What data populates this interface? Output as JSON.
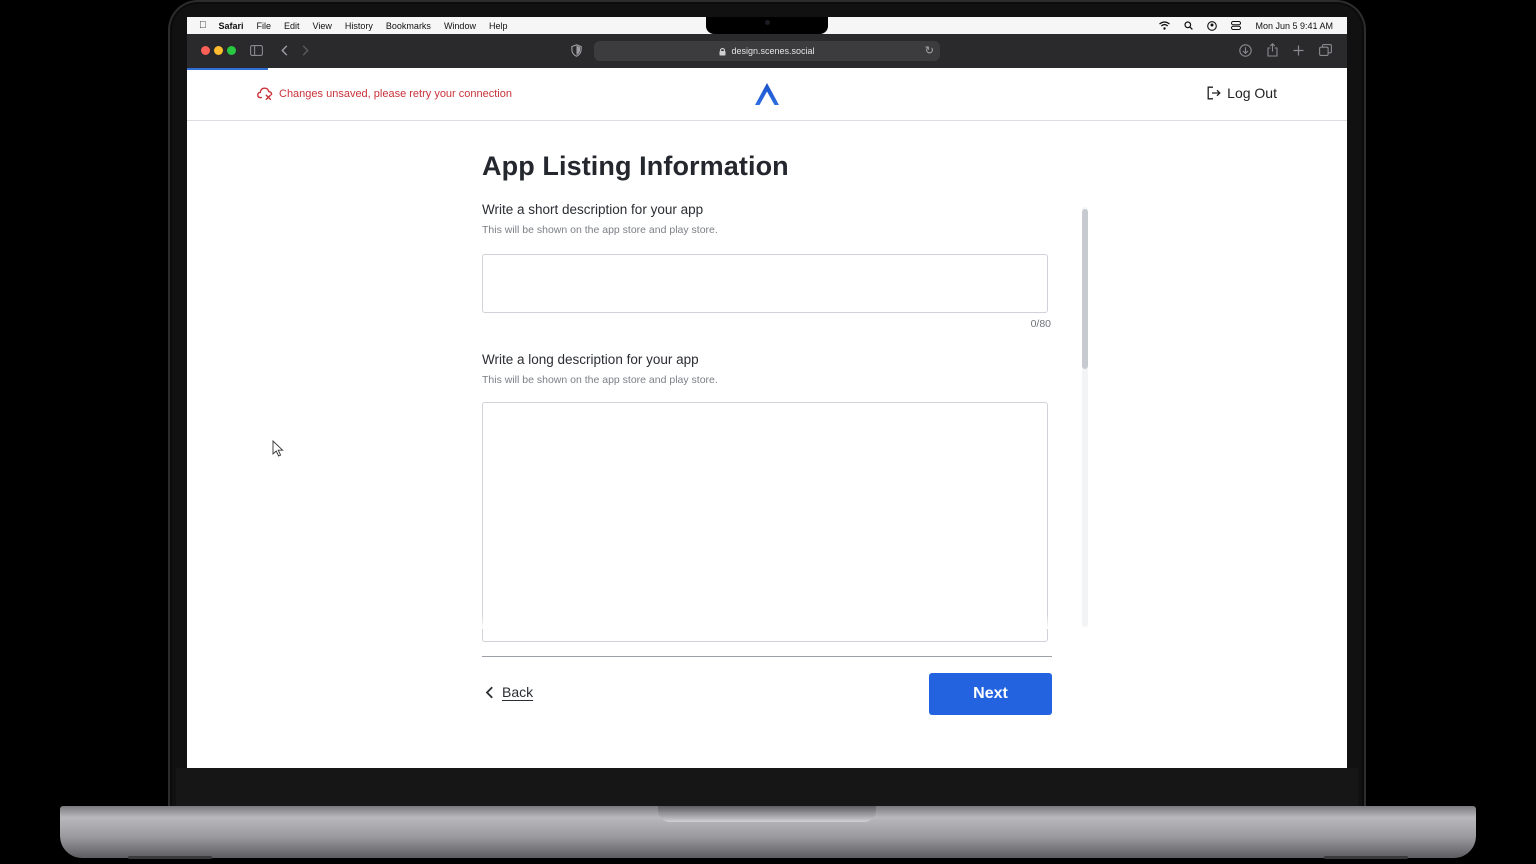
{
  "menubar": {
    "items": [
      "Safari",
      "File",
      "Edit",
      "View",
      "History",
      "Bookmarks",
      "Window",
      "Help"
    ],
    "clock": "Mon Jun 5  9:41 AM"
  },
  "browser": {
    "url": "design.scenes.social"
  },
  "header": {
    "warning": "Changes unsaved, please retry your connection",
    "logout_label": "Log Out",
    "progress_fraction": 0.07
  },
  "form": {
    "title": "App Listing Information",
    "short_label": "Write a short description for your app",
    "short_hint": "This will be shown on the app store and play store.",
    "short_value": "",
    "short_counter": "0/80",
    "long_label": "Write a long description for your app",
    "long_hint": "This will be shown on the app store and play store.",
    "long_value": ""
  },
  "footer": {
    "back_label": "Back",
    "next_label": "Next"
  },
  "colors": {
    "accent": "#2463e0",
    "warning": "#c9323a"
  }
}
